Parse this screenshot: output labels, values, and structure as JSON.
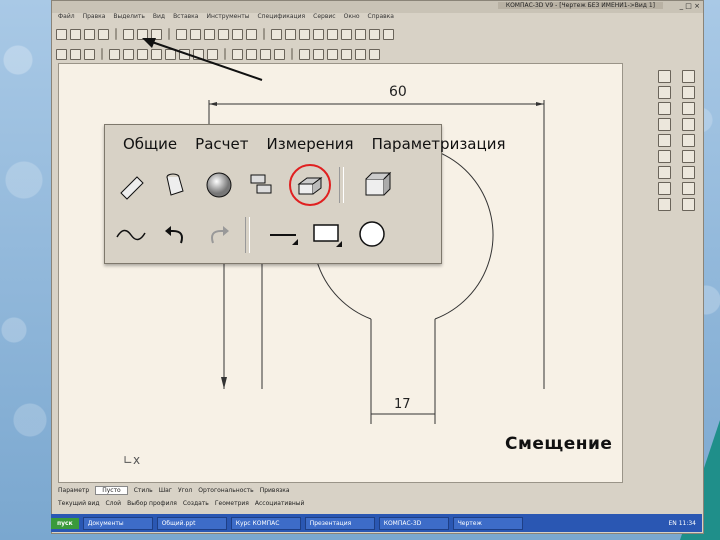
{
  "window": {
    "title": "КОМПАС-3D V9 - [Чертеж БЕЗ ИМЕНИ1->Вид 1]",
    "buttons": "_ □ ×"
  },
  "menubar": {
    "items": [
      "Файл",
      "Правка",
      "Выделить",
      "Вид",
      "Вставка",
      "Инструменты",
      "Спецификация",
      "Сервис",
      "Окно",
      "Справка"
    ]
  },
  "drawing": {
    "dimension_top": "60",
    "dimension_bottom": "17"
  },
  "overlay_panel": {
    "menu": [
      "Общие",
      "Расчет",
      "Измерения",
      "Параметризация"
    ],
    "row1_icons": [
      "extrude-icon",
      "loft-icon",
      "sphere-icon",
      "copy-transform-icon",
      "offset-icon",
      "box-icon"
    ],
    "row2_icons": [
      "curve-icon",
      "undo-icon",
      "redo-icon",
      "line-icon",
      "rectangle-icon",
      "circle-icon"
    ],
    "highlight_color": "#e02020"
  },
  "status": {
    "prop_label": "Параметр",
    "prop_value": "Пусто",
    "items": [
      "Стиль",
      "Шаг",
      "Угол",
      "Ортогональность",
      "Привязка"
    ],
    "bottom": [
      "Текущий вид",
      "Слой",
      "Выбор профиля",
      "Создать",
      "Геометрия",
      "Ассоциативный"
    ]
  },
  "taskbar": {
    "start": "пуск",
    "items": [
      "Документы",
      "Общий.ppt",
      "Курс КОМПАС",
      "Презентация",
      "КОМПАС-3D",
      "Чертеж"
    ],
    "tray": "EN 11:34"
  },
  "caption": "Смещение"
}
